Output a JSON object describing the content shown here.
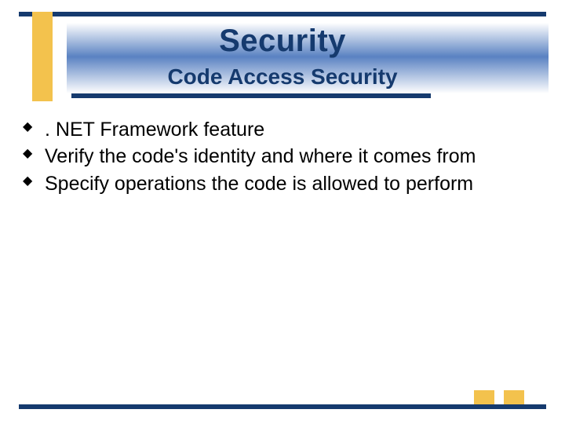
{
  "title": "Security",
  "subtitle": "Code Access Security",
  "bullets": [
    ". NET Framework feature",
    "Verify the code's identity and where it comes from",
    "Specify operations the code is allowed to perform"
  ]
}
